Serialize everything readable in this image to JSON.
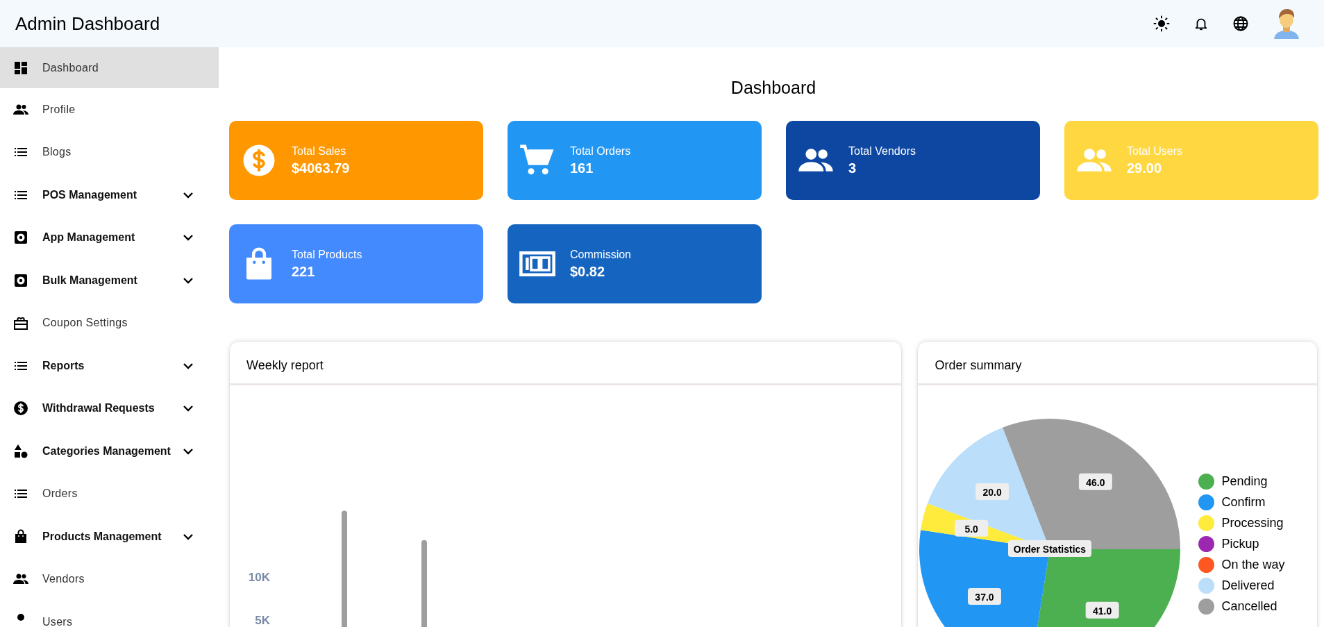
{
  "header": {
    "title": "Admin Dashboard"
  },
  "sidebar": {
    "items": [
      {
        "label": "Dashboard",
        "kind": "dashboard",
        "expandable": false,
        "selected": true
      },
      {
        "label": "Profile",
        "kind": "people",
        "expandable": false,
        "selected": false
      },
      {
        "label": "Blogs",
        "kind": "list",
        "expandable": false,
        "selected": false
      },
      {
        "label": "POS Management",
        "kind": "list",
        "expandable": true,
        "selected": false
      },
      {
        "label": "App Management",
        "kind": "gear",
        "expandable": true,
        "selected": false
      },
      {
        "label": "Bulk Management",
        "kind": "gear",
        "expandable": true,
        "selected": false
      },
      {
        "label": "Coupon Settings",
        "kind": "gift",
        "expandable": false,
        "selected": false
      },
      {
        "label": "Reports",
        "kind": "list",
        "expandable": true,
        "selected": false
      },
      {
        "label": "Withdrawal Requests",
        "kind": "dollar",
        "expandable": true,
        "selected": false
      },
      {
        "label": "Categories Management",
        "kind": "shapes",
        "expandable": true,
        "selected": false
      },
      {
        "label": "Orders",
        "kind": "list",
        "expandable": false,
        "selected": false
      },
      {
        "label": "Products Management",
        "kind": "bag",
        "expandable": true,
        "selected": false
      },
      {
        "label": "Vendors",
        "kind": "people",
        "expandable": false,
        "selected": false
      },
      {
        "label": "Users",
        "kind": "dot",
        "expandable": false,
        "selected": false
      }
    ]
  },
  "page_title": "Dashboard",
  "stat_cards": [
    {
      "label": "Total Sales",
      "value": "$4063.79",
      "kind": "dollar",
      "color": "#ff9800"
    },
    {
      "label": "Total Orders",
      "value": "161",
      "kind": "cart",
      "color": "#2196f3"
    },
    {
      "label": "Total Vendors",
      "value": "3",
      "kind": "people",
      "color": "#0d47a1"
    },
    {
      "label": "Total Users",
      "value": "29.00",
      "kind": "people",
      "color": "#ffd740"
    },
    {
      "label": "Total Products",
      "value": "221",
      "kind": "bag",
      "color": "#448aff"
    },
    {
      "label": "Commission",
      "value": "$0.82",
      "kind": "money",
      "color": "#1565c0"
    }
  ],
  "weekly_report": {
    "title": "Weekly report",
    "axis_labels": [
      "10K",
      "5K"
    ]
  },
  "order_summary": {
    "title": "Order summary",
    "chart_data": {
      "type": "pie",
      "title": "Order Statistics",
      "categories": [
        "Pending",
        "Confirm",
        "Processing",
        "Pickup",
        "On the way",
        "Delivered",
        "Cancelled"
      ],
      "values": [
        41,
        37,
        5,
        0,
        0,
        20,
        46
      ],
      "colors": [
        "#4caf50",
        "#2196f3",
        "#ffeb3b",
        "#9c27b0",
        "#ff5722",
        "#bbdefb",
        "#9e9e9e"
      ],
      "value_labels": [
        "41.0",
        "37.0",
        "5.0",
        null,
        null,
        "20.0",
        "46.0"
      ],
      "legend": "right"
    }
  }
}
